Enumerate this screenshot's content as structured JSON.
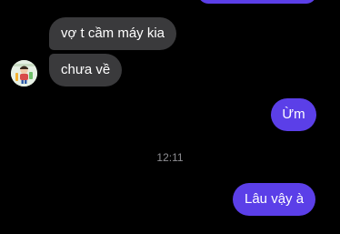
{
  "messages": {
    "incoming": [
      {
        "text": "vợ t cầm máy kia"
      },
      {
        "text": "chưa về"
      }
    ],
    "timestamp": "12:11",
    "outgoing": [
      {
        "text": "Ừm"
      },
      {
        "text": "Lâu vậy à"
      }
    ]
  },
  "colors": {
    "background": "#000000",
    "incoming_bubble": "#3a3a3c",
    "outgoing_bubble": "#5b3fe8",
    "text": "#ffffff",
    "timestamp": "#8e8e93"
  },
  "icons": {
    "avatar": "contact-avatar-image"
  }
}
